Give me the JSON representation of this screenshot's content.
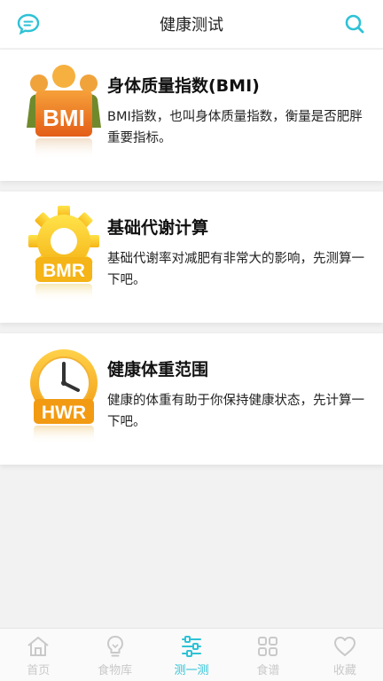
{
  "header": {
    "title": "健康测试",
    "left_icon": "chat-bubble-icon",
    "right_icon": "search-icon",
    "accent": "#2ec2d6"
  },
  "cards": [
    {
      "badge_text": "BMI",
      "badge_icon": "people-group-icon",
      "title": "身体质量指数(BMI)",
      "desc": "BMI指数，也叫身体质量指数，衡量是否肥胖重要指标。"
    },
    {
      "badge_text": "BMR",
      "badge_icon": "gear-icon",
      "title": "基础代谢计算",
      "desc": "基础代谢率对减肥有非常大的影响，先测算一下吧。"
    },
    {
      "badge_text": "HWR",
      "badge_icon": "clock-icon",
      "title": "健康体重范围",
      "desc": "健康的体重有助于你保持健康状态，先计算一下吧。"
    }
  ],
  "tabbar": {
    "items": [
      {
        "label": "首页",
        "icon": "home-icon",
        "active": false
      },
      {
        "label": "食物库",
        "icon": "lightbulb-icon",
        "active": false
      },
      {
        "label": "测一测",
        "icon": "sliders-icon",
        "active": true
      },
      {
        "label": "食谱",
        "icon": "grid-icon",
        "active": false
      },
      {
        "label": "收藏",
        "icon": "heart-icon",
        "active": false
      }
    ],
    "active_color": "#2ec2d6",
    "inactive_color": "#c9c9c9"
  }
}
